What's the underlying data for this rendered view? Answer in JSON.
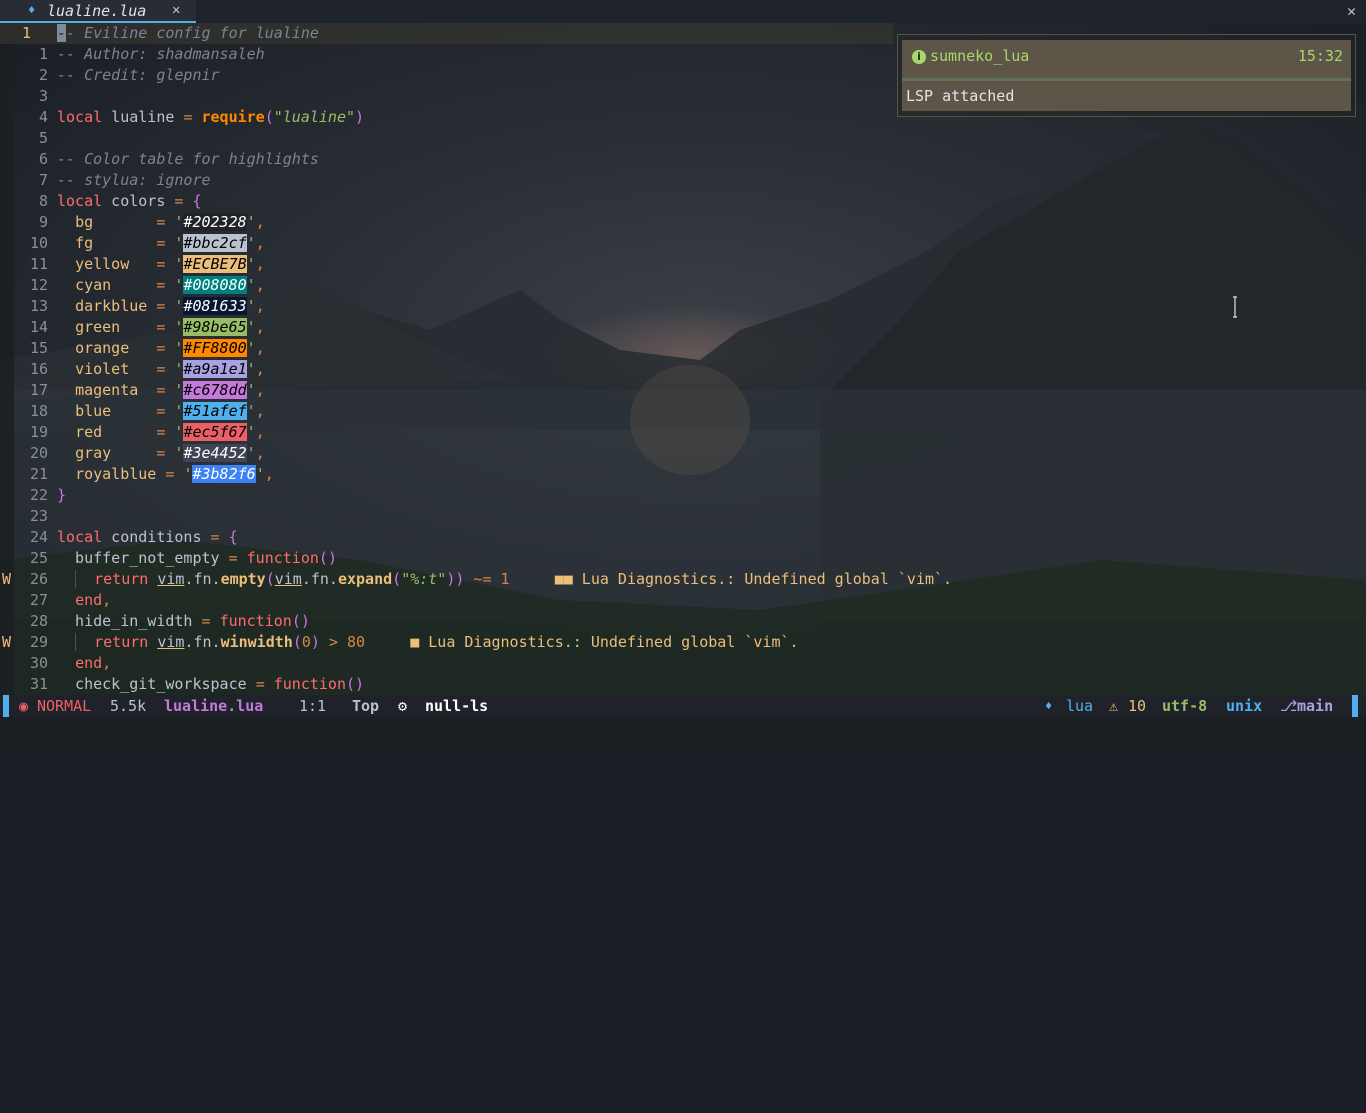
{
  "tab": {
    "icon": "lua-file-icon",
    "filename": "lualine.lua",
    "close_glyph": "✕"
  },
  "window_close_glyph": "✕",
  "notification": {
    "title": "sumneko_lua",
    "time": "15:32",
    "message": "LSP attached",
    "accent_color": "#a8d86b"
  },
  "editor": {
    "current_line_number": "1",
    "lines": [
      {
        "n": "1",
        "text": "-- Eviline config for lualine"
      },
      {
        "n": "1",
        "text": "-- Author: shadmansaleh"
      },
      {
        "n": "2",
        "text": "-- Credit: glepnir"
      },
      {
        "n": "3",
        "text": ""
      },
      {
        "n": "4",
        "text": "local lualine = require(\"lualine\")"
      },
      {
        "n": "5",
        "text": ""
      },
      {
        "n": "6",
        "text": "-- Color table for highlights"
      },
      {
        "n": "7",
        "text": "-- stylua: ignore"
      },
      {
        "n": "8",
        "text": "local colors = {"
      },
      {
        "n": "9",
        "text": "  bg       = '#202328',"
      },
      {
        "n": "10",
        "text": "  fg       = '#bbc2cf',"
      },
      {
        "n": "11",
        "text": "  yellow   = '#ECBE7B',"
      },
      {
        "n": "12",
        "text": "  cyan     = '#008080',"
      },
      {
        "n": "13",
        "text": "  darkblue = '#081633',"
      },
      {
        "n": "14",
        "text": "  green    = '#98be65',"
      },
      {
        "n": "15",
        "text": "  orange   = '#FF8800',"
      },
      {
        "n": "16",
        "text": "  violet   = '#a9a1e1',"
      },
      {
        "n": "17",
        "text": "  magenta  = '#c678dd',"
      },
      {
        "n": "18",
        "text": "  blue     = '#51afef',"
      },
      {
        "n": "19",
        "text": "  red      = '#ec5f67',"
      },
      {
        "n": "20",
        "text": "  gray     = '#3e4452',"
      },
      {
        "n": "21",
        "text": "  royalblue = '#3b82f6',"
      },
      {
        "n": "22",
        "text": "}"
      },
      {
        "n": "23",
        "text": ""
      },
      {
        "n": "24",
        "text": "local conditions = {"
      },
      {
        "n": "25",
        "text": "  buffer_not_empty = function()"
      },
      {
        "n": "26",
        "text": "    return vim.fn.empty(vim.fn.expand(\"%:t\")) ~= 1",
        "sign": "W",
        "diag_marker": "■■",
        "diag": "Lua Diagnostics.: Undefined global `vim`."
      },
      {
        "n": "27",
        "text": "  end,"
      },
      {
        "n": "28",
        "text": "  hide_in_width = function()"
      },
      {
        "n": "29",
        "text": "    return vim.fn.winwidth(0) > 80",
        "sign": "W",
        "diag_marker": "■",
        "diag": "Lua Diagnostics.: Undefined global `vim`."
      },
      {
        "n": "30",
        "text": "  end,"
      },
      {
        "n": "31",
        "text": "  check_git_workspace = function()"
      }
    ],
    "swatches": [
      {
        "key": "bg",
        "hex": "#202328",
        "fg": "#ffffff"
      },
      {
        "key": "fg",
        "hex": "#bbc2cf",
        "fg": "#000000"
      },
      {
        "key": "yellow",
        "hex": "#ECBE7B",
        "fg": "#000000"
      },
      {
        "key": "cyan",
        "hex": "#008080",
        "fg": "#ffffff"
      },
      {
        "key": "darkblue",
        "hex": "#081633",
        "fg": "#ffffff"
      },
      {
        "key": "green",
        "hex": "#98be65",
        "fg": "#000000"
      },
      {
        "key": "orange",
        "hex": "#FF8800",
        "fg": "#000000"
      },
      {
        "key": "violet",
        "hex": "#a9a1e1",
        "fg": "#000000"
      },
      {
        "key": "magenta",
        "hex": "#c678dd",
        "fg": "#000000"
      },
      {
        "key": "blue",
        "hex": "#51afef",
        "fg": "#000000"
      },
      {
        "key": "red",
        "hex": "#ec5f67",
        "fg": "#000000"
      },
      {
        "key": "gray",
        "hex": "#3e4452",
        "fg": "#ffffff"
      },
      {
        "key": "royalblue",
        "hex": "#3b82f6",
        "fg": "#ffffff"
      }
    ]
  },
  "statusline": {
    "mode_icon": "vim-mode-icon",
    "mode": "NORMAL",
    "filesize": "5.5k",
    "filename": "lualine.lua",
    "position": "1:1",
    "progress": "Top",
    "lsp_icon": "gear-icon",
    "lsp": "null-ls",
    "filetype_icon": "lua-file-icon",
    "filetype": "lua",
    "warn_icon": "warning-icon",
    "warnings": "10",
    "encoding": "utf-8",
    "fileformat": "unix",
    "branch_icon": "git-branch-icon",
    "branch": "main",
    "colors": {
      "edge": "#51afef",
      "mode": "#ec5f67",
      "filesize": "#bbc2cf",
      "filename": "#c678dd",
      "lsp": "#ffffff",
      "filetype": "#51afef",
      "warnings": "#ECBE7B",
      "encoding": "#98be65",
      "fileformat": "#51afef",
      "branch": "#a9a1e1"
    }
  }
}
